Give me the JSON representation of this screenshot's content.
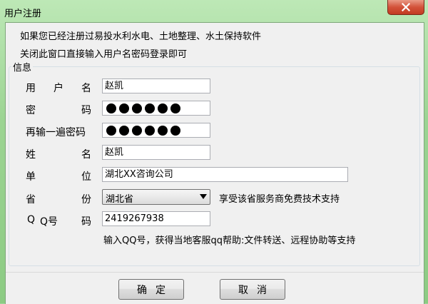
{
  "window": {
    "title": "用户注册"
  },
  "notice": {
    "line1": "如果您已经注册过易投水利水电、土地整理、水土保持软件",
    "line2": "关闭此窗口直接输入用户名密码登录即可"
  },
  "group": {
    "label": "信息"
  },
  "fields": {
    "username": {
      "label_chars": [
        "用",
        "户",
        "名"
      ],
      "value": "赵凯"
    },
    "password": {
      "label_chars": [
        "密",
        "码"
      ],
      "masked_count": 6
    },
    "confirm_password": {
      "label": "再输一遍密码",
      "masked_count": 6
    },
    "name": {
      "label_chars": [
        "姓",
        "名"
      ],
      "value": "赵凯"
    },
    "company": {
      "label_chars": [
        "单",
        "位"
      ],
      "value": "湖北XX咨询公司"
    },
    "province": {
      "label_chars": [
        "省",
        "份"
      ],
      "value": "湖北省",
      "hint": "享受该省服务商免费技术支持"
    },
    "qq": {
      "label_chars": [
        "Q",
        "Q号",
        "码"
      ],
      "value": "2419267938",
      "hint": "输入QQ号，获得当地客服qq帮助:文件转送、远程协助等支持"
    }
  },
  "buttons": {
    "ok": "确定",
    "cancel": "取消"
  },
  "icons": {
    "close": "close-icon",
    "dropdown": "chevron-down-icon"
  }
}
